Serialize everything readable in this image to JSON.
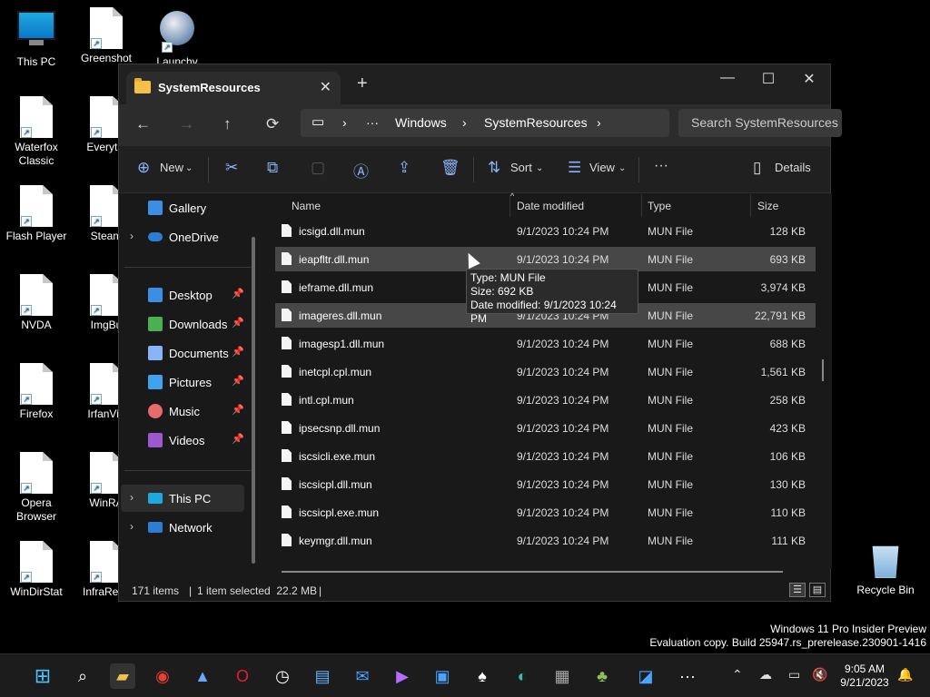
{
  "desktop": {
    "icons": [
      {
        "label": "This PC"
      },
      {
        "label": "Greenshot"
      },
      {
        "label": "Launchy"
      },
      {
        "label": "Waterfox Classic"
      },
      {
        "label": "Everythi"
      },
      {
        "label": "Flash Player"
      },
      {
        "label": "Steam"
      },
      {
        "label": "NVDA"
      },
      {
        "label": "ImgBu"
      },
      {
        "label": "Firefox"
      },
      {
        "label": "IrfanVie"
      },
      {
        "label": "Opera Browser"
      },
      {
        "label": "WinRA"
      },
      {
        "label": "WinDirStat"
      },
      {
        "label": "InfraReco"
      }
    ],
    "recycle_bin": "Recycle Bin",
    "watermark_line1": "Windows 11 Pro Insider Preview",
    "watermark_line2": "Evaluation copy. Build 25947.rs_prerelease.230901-1416"
  },
  "window": {
    "tab_title": "SystemResources",
    "new_tab": "+",
    "minimize": "—",
    "maximize": "☐",
    "close": "✕",
    "nav": {
      "back": "←",
      "forward": "→",
      "up": "↑",
      "refresh": "⟳"
    },
    "breadcrumb": {
      "more": "···",
      "items": [
        "Windows",
        "SystemResources"
      ]
    },
    "search_placeholder": "Search SystemResources",
    "toolbar": {
      "new": "New",
      "sort": "Sort",
      "view": "View",
      "more": "···",
      "details": "Details"
    },
    "sidebar": {
      "gallery": "Gallery",
      "onedrive": "OneDrive",
      "quick": [
        {
          "label": "Desktop",
          "color": "#3a8ee6"
        },
        {
          "label": "Downloads",
          "color": "#4caf50"
        },
        {
          "label": "Documents",
          "color": "#8ab4f8"
        },
        {
          "label": "Pictures",
          "color": "#3fa3f0"
        },
        {
          "label": "Music",
          "color": "#e86a6a"
        },
        {
          "label": "Videos",
          "color": "#9b59d0"
        }
      ],
      "this_pc": "This PC",
      "network": "Network"
    },
    "columns": {
      "name": "Name",
      "date": "Date modified",
      "type": "Type",
      "size": "Size"
    },
    "files": [
      {
        "name": "icsigd.dll.mun",
        "date": "9/1/2023 10:24 PM",
        "type": "MUN File",
        "size": "128 KB"
      },
      {
        "name": "ieapfltr.dll.mun",
        "date": "9/1/2023 10:24 PM",
        "type": "MUN File",
        "size": "693 KB"
      },
      {
        "name": "ieframe.dll.mun",
        "date": "9/1/2023 10:24 PM",
        "type": "MUN File",
        "size": "3,974 KB"
      },
      {
        "name": "imageres.dll.mun",
        "date": "9/1/2023 10:24 PM",
        "type": "MUN File",
        "size": "22,791 KB"
      },
      {
        "name": "imagesp1.dll.mun",
        "date": "9/1/2023 10:24 PM",
        "type": "MUN File",
        "size": "688 KB"
      },
      {
        "name": "inetcpl.cpl.mun",
        "date": "9/1/2023 10:24 PM",
        "type": "MUN File",
        "size": "1,561 KB"
      },
      {
        "name": "intl.cpl.mun",
        "date": "9/1/2023 10:24 PM",
        "type": "MUN File",
        "size": "258 KB"
      },
      {
        "name": "ipsecsnp.dll.mun",
        "date": "9/1/2023 10:24 PM",
        "type": "MUN File",
        "size": "423 KB"
      },
      {
        "name": "iscsicli.exe.mun",
        "date": "9/1/2023 10:24 PM",
        "type": "MUN File",
        "size": "106 KB"
      },
      {
        "name": "iscsicpl.dll.mun",
        "date": "9/1/2023 10:24 PM",
        "type": "MUN File",
        "size": "130 KB"
      },
      {
        "name": "iscsicpl.exe.mun",
        "date": "9/1/2023 10:24 PM",
        "type": "MUN File",
        "size": "110 KB"
      },
      {
        "name": "keymgr.dll.mun",
        "date": "9/1/2023 10:24 PM",
        "type": "MUN File",
        "size": "111 KB"
      }
    ],
    "tooltip": {
      "type": "Type: MUN File",
      "size": "Size: 692 KB",
      "date": "Date modified: 9/1/2023 10:24 PM"
    },
    "status": {
      "items": "171 items",
      "selected": "1 item selected  22.2 MB"
    }
  },
  "taskbar": {
    "time": "9:05 AM",
    "date": "9/21/2023"
  }
}
